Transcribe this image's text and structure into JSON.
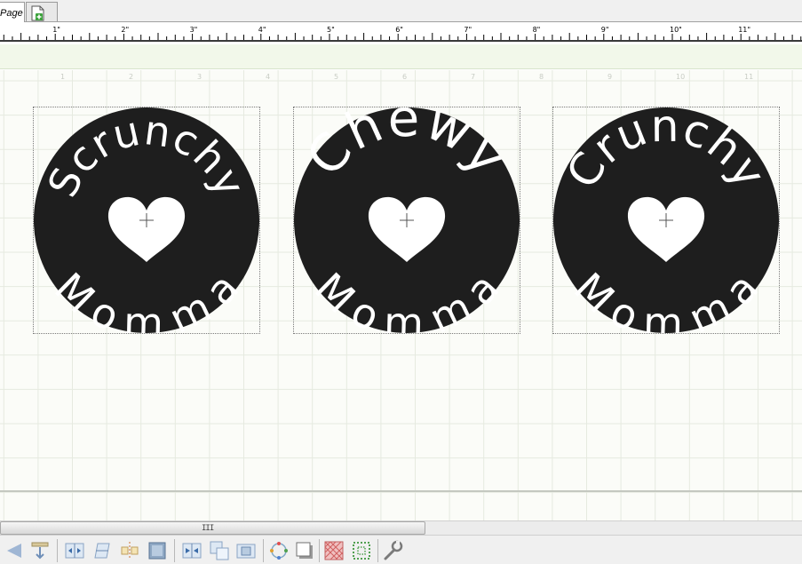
{
  "tabs": {
    "page_label": "Page",
    "add_page_icon": "add-page-icon"
  },
  "ruler": {
    "labels": [
      "1\"",
      "2\"",
      "3\"",
      "4\"",
      "5\"",
      "6\"",
      "7\"",
      "8\"",
      "9\"",
      "10\"",
      "11\""
    ]
  },
  "canvas": {
    "page_numbers": [
      "1",
      "2",
      "3",
      "4",
      "5",
      "6",
      "7",
      "8",
      "9",
      "10",
      "11"
    ],
    "designs": [
      {
        "top_word": "Scrunchy",
        "bottom_word": "Momma"
      },
      {
        "top_word": "Chewy",
        "bottom_word": "Momma"
      },
      {
        "top_word": "Crunchy",
        "bottom_word": "Momma"
      }
    ],
    "colors": {
      "disc": "#1e1e1e",
      "letters": "#ffffff",
      "grid": "#e4e8de",
      "strip": "#f2f8ea"
    }
  },
  "scrollbar": {
    "grip": "III"
  },
  "toolbar": {
    "tools": [
      "back-arrow-icon",
      "paste-icon",
      "flip-horizontal-icon",
      "flip-vertical-icon",
      "center-align-icon",
      "fill-icon",
      "align-distribute-icon",
      "front-icon",
      "group-icon",
      "rotate-icon",
      "shadow-icon",
      "pattern-fill-icon",
      "dotted-frame-icon",
      "wrench-icon"
    ]
  }
}
